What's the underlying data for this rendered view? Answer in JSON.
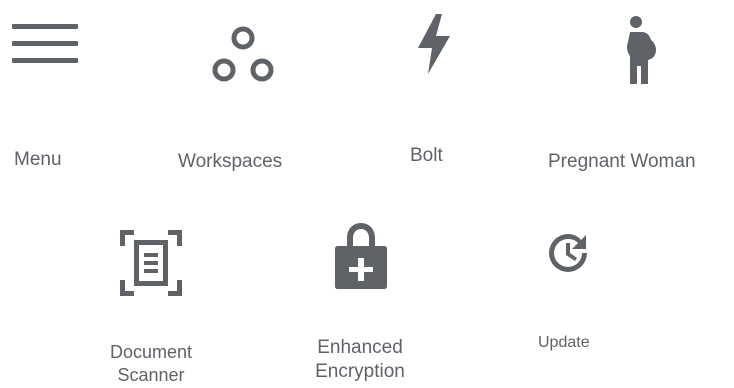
{
  "icons": [
    {
      "name": "menu-icon",
      "label": "Menu"
    },
    {
      "name": "workspaces-icon",
      "label": "Workspaces"
    },
    {
      "name": "bolt-icon",
      "label": "Bolt"
    },
    {
      "name": "pregnant-woman-icon",
      "label": "Pregnant Woman"
    },
    {
      "name": "document-scanner-icon",
      "label_line1": "Document",
      "label_line2": "Scanner"
    },
    {
      "name": "enhanced-encryption-icon",
      "label_line1": "Enhanced",
      "label_line2": "Encryption"
    },
    {
      "name": "update-icon",
      "label": "Update"
    }
  ]
}
